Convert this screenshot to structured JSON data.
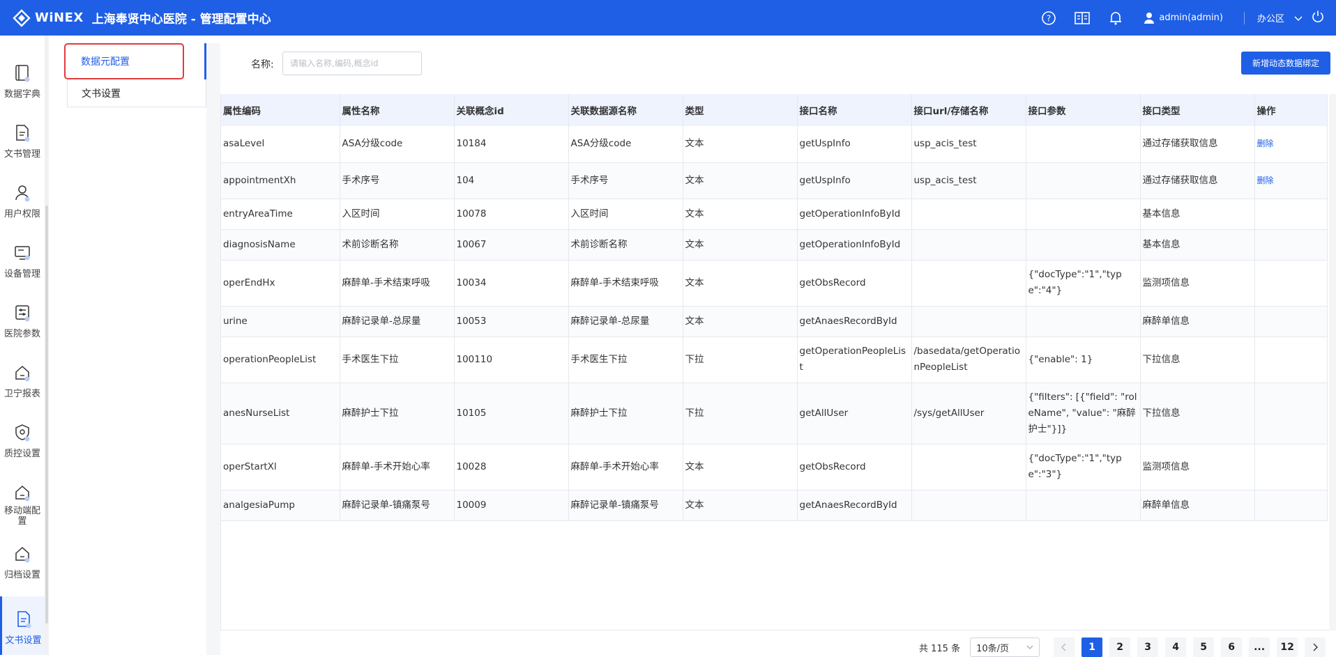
{
  "header": {
    "brand": "WiNEX",
    "title": "上海奉贤中心医院 - 管理配置中心",
    "user": "admin(admin)",
    "office": "办公区",
    "icons": [
      "help-icon",
      "book-icon",
      "bell-icon",
      "user-icon",
      "chevron-down-icon",
      "power-icon"
    ]
  },
  "rail": {
    "items": [
      {
        "label": "数据字典",
        "icon": "book-icon"
      },
      {
        "label": "文书管理",
        "icon": "document-icon"
      },
      {
        "label": "用户权限",
        "icon": "user-icon"
      },
      {
        "label": "设备管理",
        "icon": "monitor-icon"
      },
      {
        "label": "医院参数",
        "icon": "sliders-icon"
      },
      {
        "label": "卫宁报表",
        "icon": "home-icon"
      },
      {
        "label": "质控设置",
        "icon": "shield-icon"
      },
      {
        "label": "移动端配置",
        "icon": "home-icon"
      },
      {
        "label": "归档设置",
        "icon": "home-icon"
      },
      {
        "label": "文书设置",
        "icon": "document-icon"
      }
    ]
  },
  "submenu": {
    "items": [
      {
        "label": "数据元配置"
      },
      {
        "label": "文书设置"
      }
    ]
  },
  "filter": {
    "label": "名称:",
    "placeholder": "请输入名称,编码,概念id",
    "add_button": "新增动态数据绑定"
  },
  "table": {
    "columns": [
      "属性编码",
      "属性名称",
      "关联概念id",
      "关联数据源名称",
      "类型",
      "接口名称",
      "接口url/存储名称",
      "接口参数",
      "接口类型",
      "操作"
    ],
    "rows": [
      [
        "asaLevel",
        "ASA分级code",
        "10184",
        "ASA分级code",
        "文本",
        "getUspInfo",
        "usp_acis_test",
        "",
        "通过存储获取信息",
        "删除"
      ],
      [
        "appointmentXh",
        "手术序号",
        "104",
        "手术序号",
        "文本",
        "getUspInfo",
        "usp_acis_test",
        "",
        "通过存储获取信息",
        "删除"
      ],
      [
        "entryAreaTime",
        "入区时间",
        "10078",
        "入区时间",
        "文本",
        "getOperationInfoById",
        "",
        "",
        "基本信息",
        ""
      ],
      [
        "diagnosisName",
        "术前诊断名称",
        "10067",
        "术前诊断名称",
        "文本",
        "getOperationInfoById",
        "",
        "",
        "基本信息",
        ""
      ],
      [
        "operEndHx",
        "麻醉单-手术结束呼吸",
        "10034",
        "麻醉单-手术结束呼吸",
        "文本",
        "getObsRecord",
        "",
        "{\"docType\":\"1\",\"type\":\"4\"}",
        "监测项信息",
        ""
      ],
      [
        "urine",
        "麻醉记录单-总尿量",
        "10053",
        "麻醉记录单-总尿量",
        "文本",
        "getAnaesRecordById",
        "",
        "",
        "麻醉单信息",
        ""
      ],
      [
        "operationPeopleList",
        "手术医生下拉",
        "100110",
        "手术医生下拉",
        "下拉",
        "getOperationPeopleList",
        "/basedata/getOperationPeopleList",
        "{\"enable\": 1}",
        "下拉信息",
        ""
      ],
      [
        "anesNurseList",
        "麻醉护士下拉",
        "10105",
        "麻醉护士下拉",
        "下拉",
        "getAllUser",
        "/sys/getAllUser",
        "{\"filters\": [{\"field\": \"roleName\", \"value\": \"麻醉护士\"}]}",
        "下拉信息",
        ""
      ],
      [
        "operStartXl",
        "麻醉单-手术开始心率",
        "10028",
        "麻醉单-手术开始心率",
        "文本",
        "getObsRecord",
        "",
        "{\"docType\":\"1\",\"type\":\"3\"}",
        "监测项信息",
        ""
      ],
      [
        "analgesiaPump",
        "麻醉记录单-镇痛泵号",
        "10009",
        "麻醉记录单-镇痛泵号",
        "文本",
        "getAnaesRecordById",
        "",
        "",
        "麻醉单信息",
        ""
      ]
    ]
  },
  "pagination": {
    "total_text": "共 115 条",
    "page_size": "10条/页",
    "pages": [
      "1",
      "2",
      "3",
      "4",
      "5",
      "6",
      "...",
      "12"
    ],
    "current": "1",
    "colors": {
      "accent": "#1f5fe6"
    }
  }
}
